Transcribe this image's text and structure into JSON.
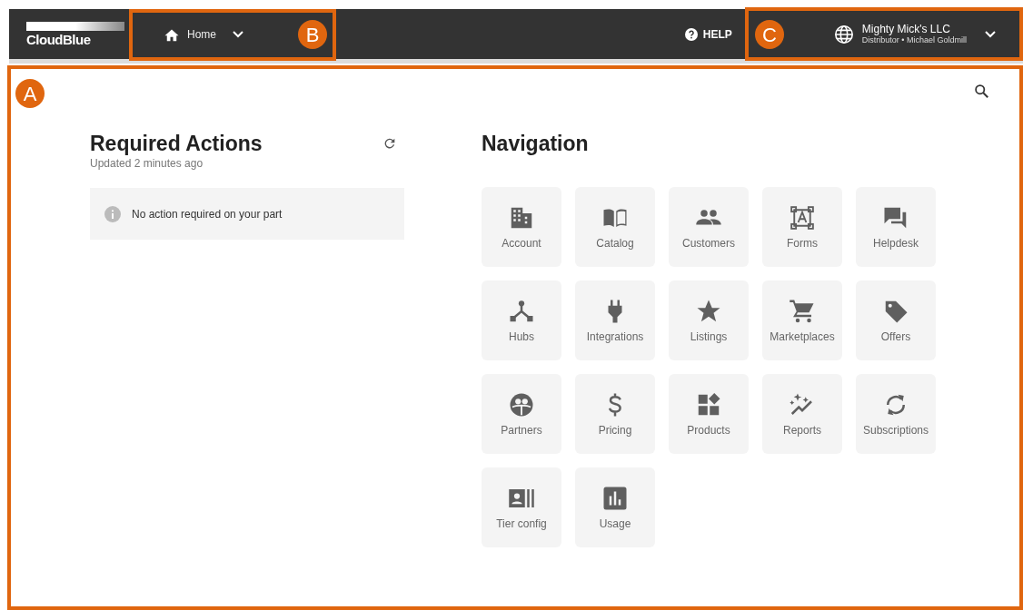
{
  "header": {
    "logo": "CloudBlue",
    "home_menu": {
      "label": "Home"
    },
    "help": "HELP",
    "account": {
      "name": "Mighty Mick's LLC",
      "subtitle": "Distributor • Michael Goldmill"
    }
  },
  "callouts": [
    {
      "label": "A",
      "kind": "content"
    },
    {
      "label": "B",
      "kind": "home"
    },
    {
      "label": "C",
      "kind": "account"
    }
  ],
  "required_actions": {
    "title": "Required Actions",
    "updated": "Updated 2 minutes ago",
    "message": "No action required on your part"
  },
  "navigation": {
    "title": "Navigation",
    "items": [
      {
        "label": "Account"
      },
      {
        "label": "Catalog"
      },
      {
        "label": "Customers"
      },
      {
        "label": "Forms"
      },
      {
        "label": "Helpdesk"
      },
      {
        "label": "Hubs"
      },
      {
        "label": "Integrations"
      },
      {
        "label": "Listings"
      },
      {
        "label": "Marketplaces"
      },
      {
        "label": "Offers"
      },
      {
        "label": "Partners"
      },
      {
        "label": "Pricing"
      },
      {
        "label": "Products"
      },
      {
        "label": "Reports"
      },
      {
        "label": "Subscriptions"
      },
      {
        "label": "Tier config"
      },
      {
        "label": "Usage"
      }
    ]
  }
}
